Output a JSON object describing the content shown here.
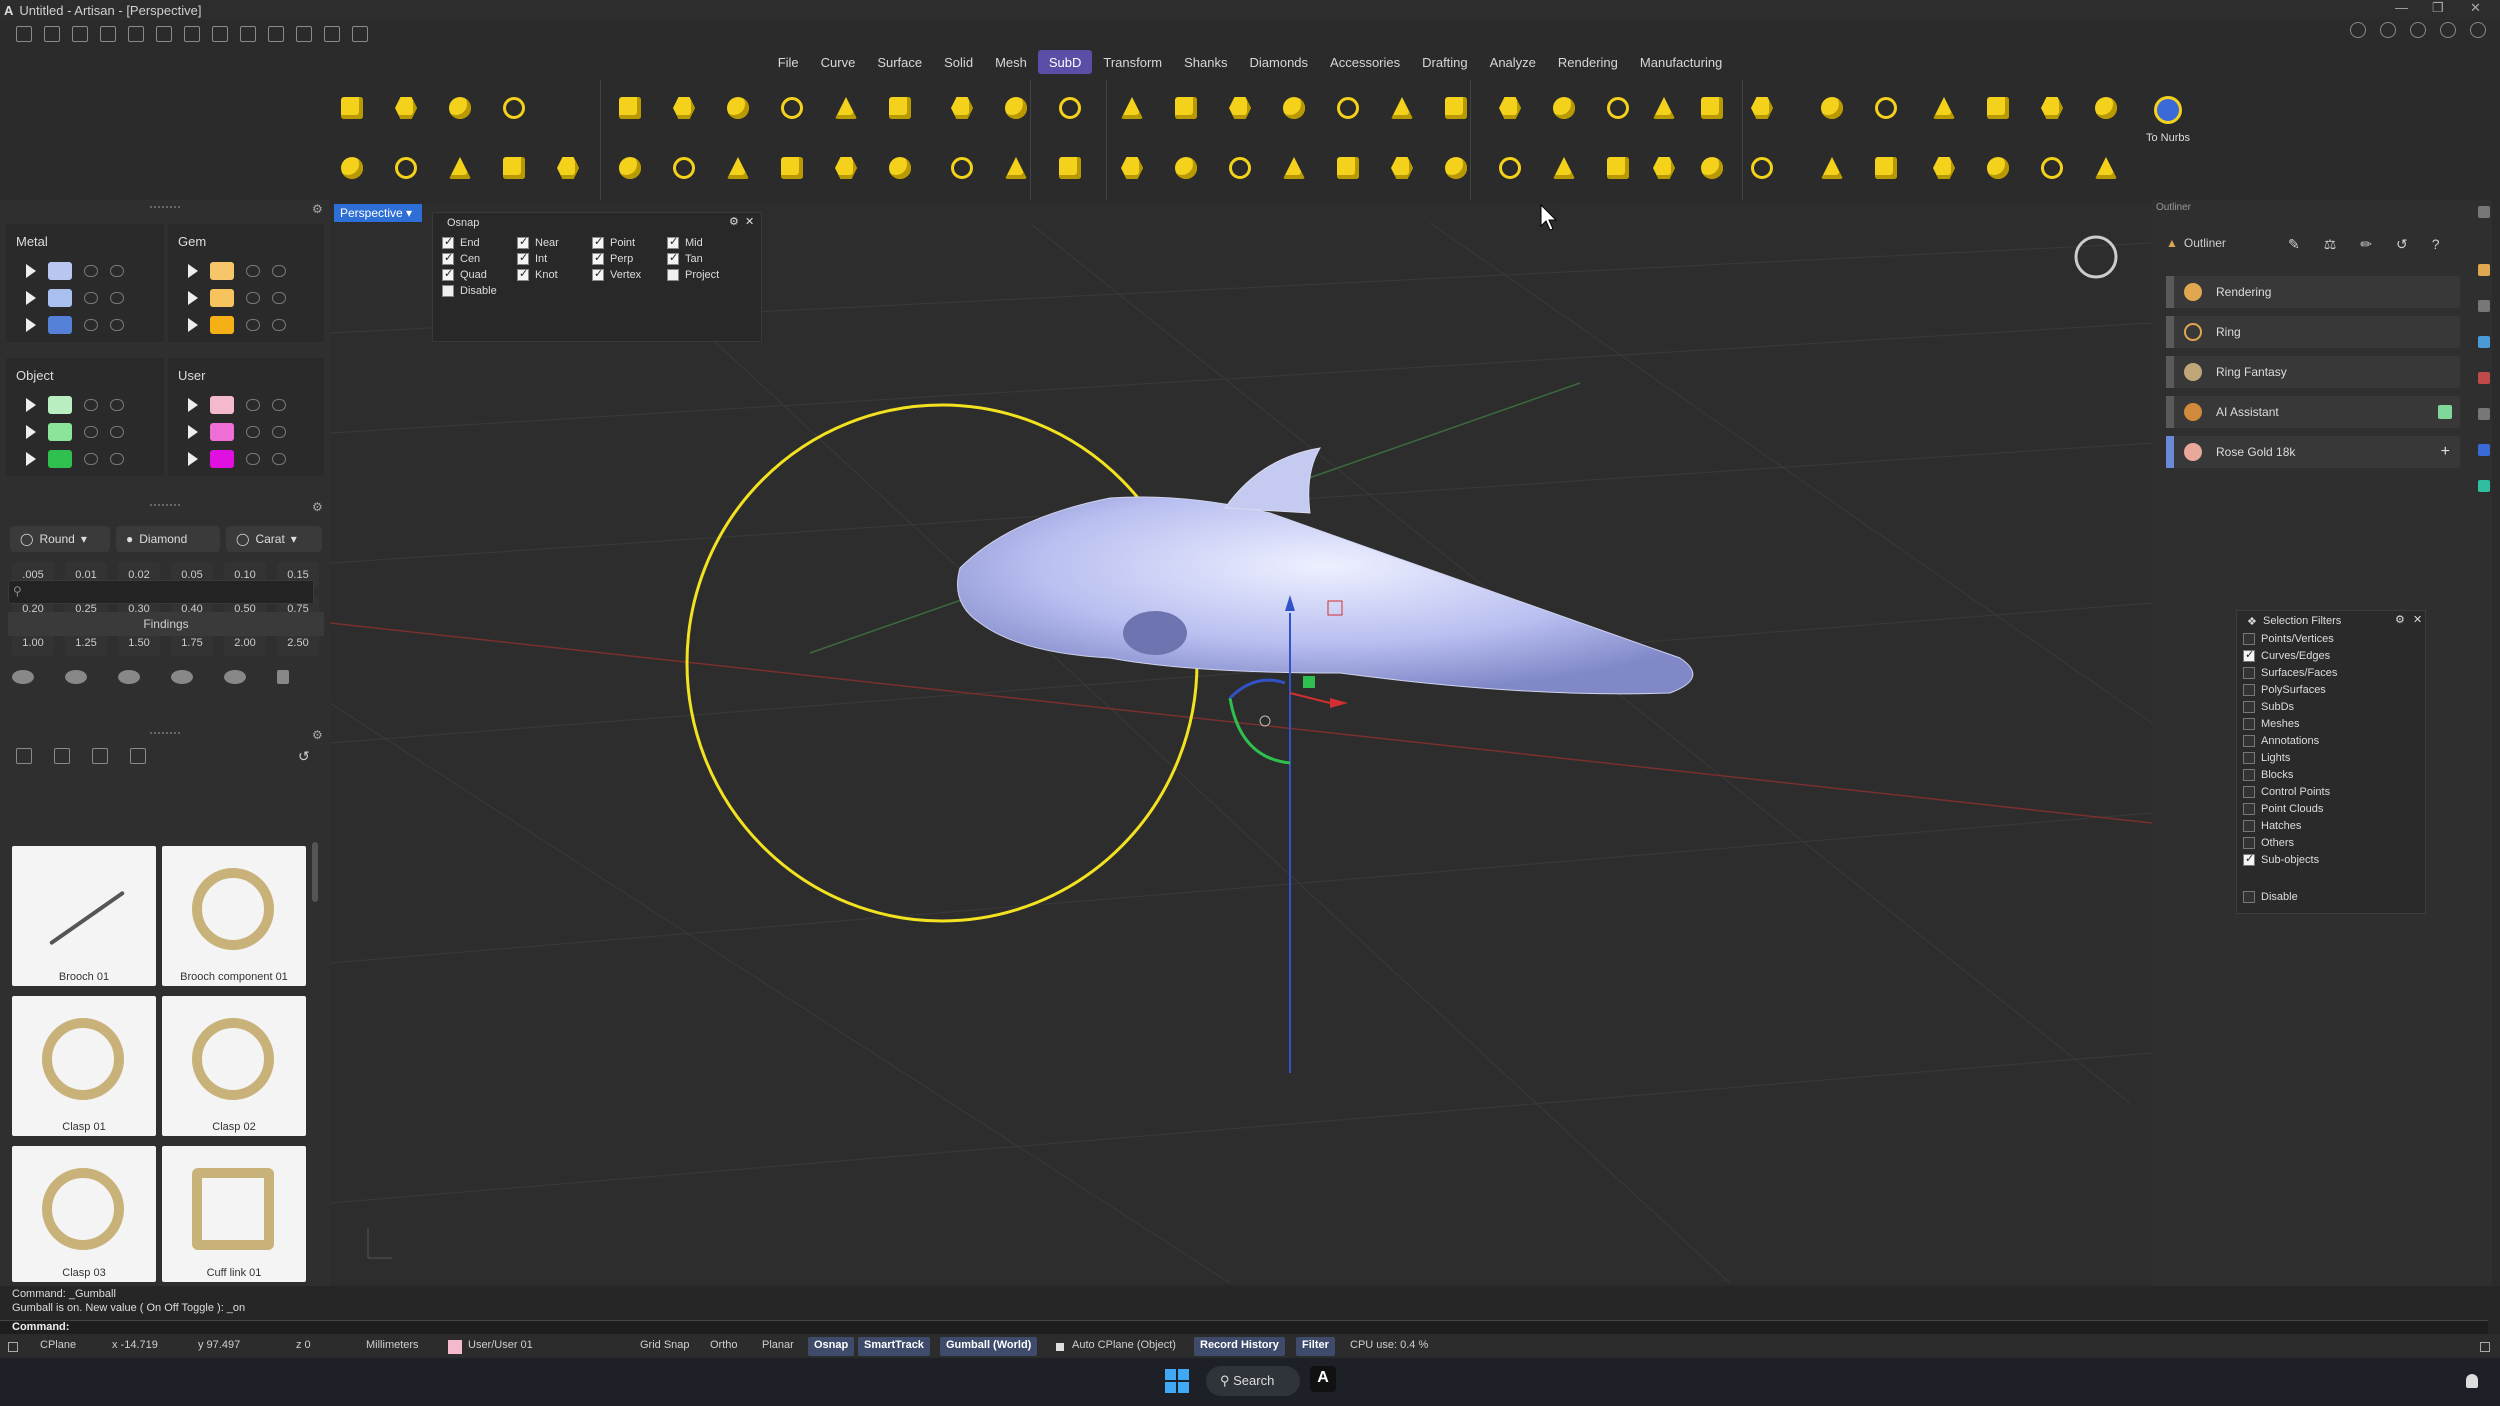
{
  "titlebar": {
    "title": "Untitled - Artisan - [Perspective]"
  },
  "menu": {
    "items": [
      "File",
      "Curve",
      "Surface",
      "Solid",
      "Mesh",
      "SubD",
      "Transform",
      "Shanks",
      "Diamonds",
      "Accessories",
      "Drafting",
      "Analyze",
      "Rendering",
      "Manufacturing"
    ],
    "active": "SubD"
  },
  "toolbar": {
    "to_nurbs_label": "To Nurbs"
  },
  "layers": {
    "metal": {
      "title": "Metal",
      "swatches": [
        "#b9c6f2",
        "#a9bff0",
        "#5580d8"
      ]
    },
    "gem": {
      "title": "Gem",
      "swatches": [
        "#f7c56a",
        "#f6c35e",
        "#f5b015"
      ]
    },
    "object": {
      "title": "Object",
      "swatches": [
        "#b8eec0",
        "#8ae49a",
        "#2fbf4f"
      ]
    },
    "user": {
      "title": "User",
      "swatches": [
        "#f4b9cc",
        "#ee6ed6",
        "#e010e0"
      ]
    }
  },
  "gems": {
    "shape": "Round",
    "type": "Diamond",
    "unit": "Carat",
    "sizes": [
      ".005",
      "0.01",
      "0.02",
      "0.05",
      "0.10",
      "0.15",
      "0.20",
      "0.25",
      "0.30",
      "0.40",
      "0.50",
      "0.75",
      "1.00",
      "1.25",
      "1.50",
      "1.75",
      "2.00",
      "2.50"
    ]
  },
  "library": {
    "search_placeholder": "",
    "category": "Findings",
    "items": [
      "Brooch 01",
      "Brooch component 01",
      "Clasp 01",
      "Clasp 02",
      "Clasp 03",
      "Cuff link 01"
    ]
  },
  "viewport": {
    "name": "Perspective",
    "osnap": {
      "title": "Osnap",
      "options": [
        {
          "label": "End",
          "checked": true
        },
        {
          "label": "Near",
          "checked": true
        },
        {
          "label": "Point",
          "checked": true
        },
        {
          "label": "Mid",
          "checked": true
        },
        {
          "label": "Cen",
          "checked": true
        },
        {
          "label": "Int",
          "checked": true
        },
        {
          "label": "Perp",
          "checked": true
        },
        {
          "label": "Tan",
          "checked": true
        },
        {
          "label": "Quad",
          "checked": true
        },
        {
          "label": "Knot",
          "checked": true
        },
        {
          "label": "Vertex",
          "checked": true
        },
        {
          "label": "Project",
          "checked": false
        },
        {
          "label": "Disable",
          "checked": false
        }
      ]
    }
  },
  "outliner": {
    "panel_label": "Outliner",
    "tab": "Outliner",
    "items": [
      "Rendering",
      "Ring",
      "Ring Fantasy",
      "AI Assistant",
      "Rose Gold 18k"
    ]
  },
  "selection_filters": {
    "title": "Selection Filters",
    "items": [
      {
        "label": "Points/Vertices",
        "checked": false
      },
      {
        "label": "Curves/Edges",
        "checked": true
      },
      {
        "label": "Surfaces/Faces",
        "checked": false
      },
      {
        "label": "PolySurfaces",
        "checked": false
      },
      {
        "label": "SubDs",
        "checked": false
      },
      {
        "label": "Meshes",
        "checked": false
      },
      {
        "label": "Annotations",
        "checked": false
      },
      {
        "label": "Lights",
        "checked": false
      },
      {
        "label": "Blocks",
        "checked": false
      },
      {
        "label": "Control Points",
        "checked": false
      },
      {
        "label": "Point Clouds",
        "checked": false
      },
      {
        "label": "Hatches",
        "checked": false
      },
      {
        "label": "Others",
        "checked": false
      },
      {
        "label": "Sub-objects",
        "checked": true
      }
    ],
    "disable": "Disable"
  },
  "command": {
    "history": [
      "Command: _Gumball",
      "Gumball is on. New value ( On  Off  Toggle ): _on"
    ],
    "prompt": "Command:"
  },
  "status": {
    "cplane": "CPlane",
    "x": "x -14.719",
    "y": "y 97.497",
    "z": "z 0",
    "units": "Millimeters",
    "layer": "User/User 01",
    "grid_snap": "Grid Snap",
    "ortho": "Ortho",
    "planar": "Planar",
    "osnap": "Osnap",
    "smarttrack": "SmartTrack",
    "gumball": "Gumball (World)",
    "auto_cplane": "Auto CPlane (Object)",
    "record_history": "Record History",
    "filter": "Filter",
    "cpu": "CPU use: 0.4 %"
  },
  "taskbar": {
    "search": "Search",
    "app_icon": "A"
  }
}
